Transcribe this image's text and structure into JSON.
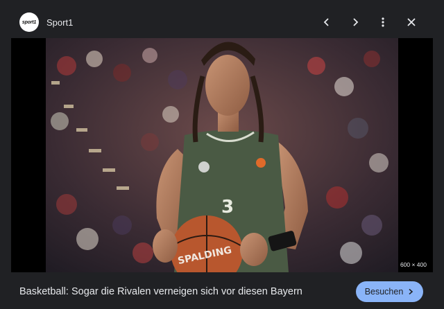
{
  "header": {
    "logo_text": "sport1",
    "source_name": "Sport1",
    "icons": [
      "chevron-left-icon",
      "chevron-right-icon",
      "more-vert-icon",
      "close-icon"
    ]
  },
  "image": {
    "dimensions_label": "600 × 400",
    "jersey": {
      "number": "3",
      "ball_brand": "SPALDING"
    }
  },
  "footer": {
    "headline": "Basketball: Sogar die Rivalen verneigen sich vor diesen Bayern",
    "visit_label": "Besuchen"
  },
  "colors": {
    "background": "#202124",
    "button": "#8ab4f8",
    "jersey": "#4a5a44"
  }
}
